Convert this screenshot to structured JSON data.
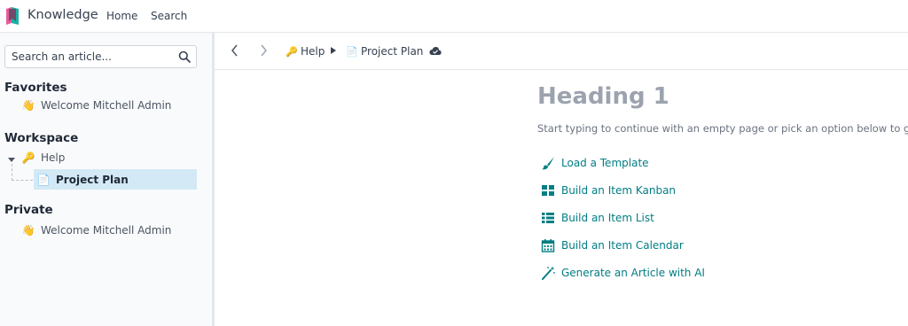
{
  "navbar": {
    "app_name": "Knowledge",
    "links": [
      "Home",
      "Search"
    ]
  },
  "sidebar": {
    "search_placeholder": "Search an article...",
    "sections": {
      "favorites": {
        "title": "Favorites",
        "items": [
          {
            "emoji": "👋",
            "label": "Welcome Mitchell Admin"
          }
        ]
      },
      "workspace": {
        "title": "Workspace",
        "items": [
          {
            "emoji": "🔑",
            "label": "Help"
          },
          {
            "emoji": "📄",
            "label": "Project Plan",
            "selected": true
          }
        ]
      },
      "private": {
        "title": "Private",
        "items": [
          {
            "emoji": "👋",
            "label": "Welcome Mitchell Admin"
          }
        ]
      }
    }
  },
  "header": {
    "breadcrumb": [
      {
        "emoji": "🔑",
        "label": "Help"
      },
      {
        "emoji": "📄",
        "label": "Project Plan"
      }
    ]
  },
  "main": {
    "heading": "Heading 1",
    "hint": "Start typing to continue with an empty page or pick an option below to get star",
    "actions": [
      {
        "icon": "paintbrush-icon",
        "label": "Load a Template"
      },
      {
        "icon": "kanban-icon",
        "label": "Build an Item Kanban"
      },
      {
        "icon": "list-icon",
        "label": "Build an Item List"
      },
      {
        "icon": "calendar-icon",
        "label": "Build an Item Calendar"
      },
      {
        "icon": "magic-wand-icon",
        "label": "Generate an Article with AI"
      }
    ]
  },
  "colors": {
    "accent": "#017e84",
    "selected_bg": "#d3e9f5",
    "heading_gray": "#9ca3af"
  }
}
